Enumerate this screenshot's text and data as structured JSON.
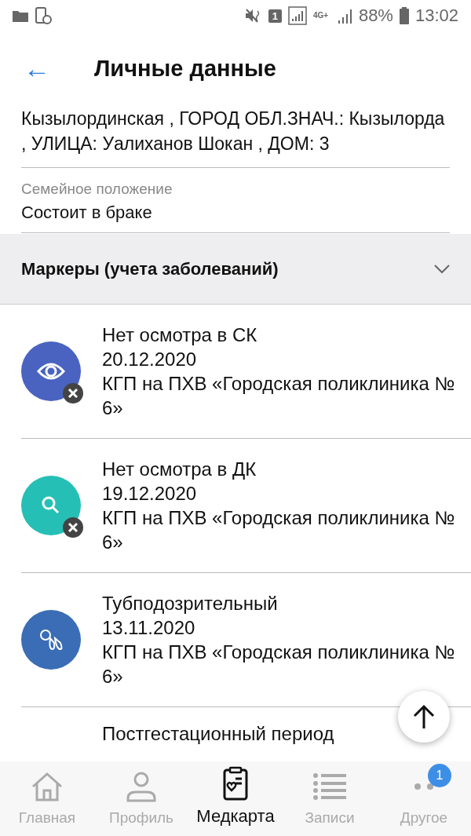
{
  "status_bar": {
    "sim": "1",
    "network": "4G+",
    "battery": "88%",
    "time": "13:02"
  },
  "header": {
    "back": "←",
    "title": "Личные данные"
  },
  "address": "Кызылординская , ГОРОД ОБЛ.ЗНАЧ.: Кызылорда , УЛИЦА: Уалиханов Шокан , ДОМ: 3",
  "marital": {
    "label": "Семейное положение",
    "value": "Состоит в браке"
  },
  "section": {
    "title": "Маркеры (учета заболеваний)",
    "expanded": true
  },
  "markers": [
    {
      "kind": "eye",
      "color": "#4a63c0",
      "removed": true,
      "title": "Нет осмотра в СК",
      "date": "20.12.2020",
      "org": "КГП на ПХВ «Городская поликлиника № 6»"
    },
    {
      "kind": "search",
      "color": "#26bfb5",
      "removed": true,
      "title": "Нет осмотра в ДК",
      "date": "19.12.2020",
      "org": "КГП на ПХВ «Городская поликлиника № 6»"
    },
    {
      "kind": "lungs",
      "color": "#3a6db5",
      "removed": false,
      "title": "Тубподозрительный",
      "date": "13.11.2020",
      "org": "КГП на ПХВ «Городская поликлиника № 6»"
    },
    {
      "kind": "partial",
      "title": "Постгестационный период"
    }
  ],
  "nav": [
    {
      "kind": "home",
      "label": "Главная",
      "selected": false
    },
    {
      "kind": "person",
      "label": "Профиль",
      "selected": false
    },
    {
      "kind": "card",
      "label": "Медкарта",
      "selected": true
    },
    {
      "kind": "list",
      "label": "Записи",
      "selected": false
    },
    {
      "kind": "more",
      "label": "Другое",
      "selected": false,
      "badge": "1"
    }
  ]
}
